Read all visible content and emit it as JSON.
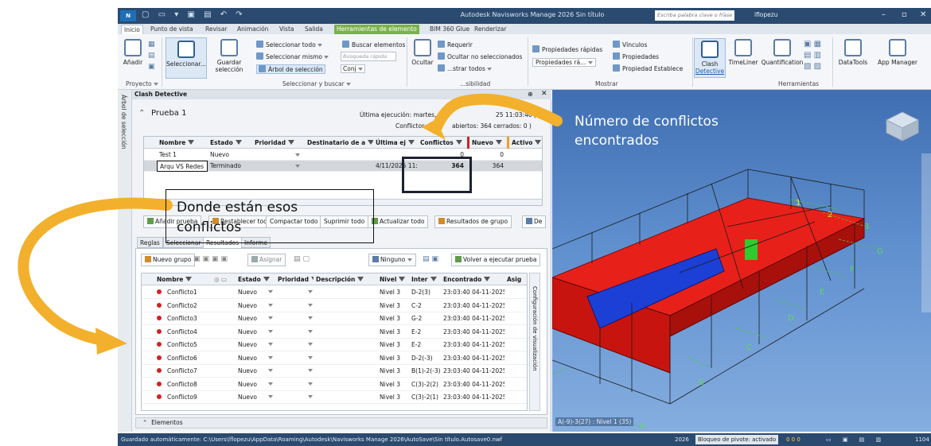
{
  "window": {
    "title": "Autodesk Navisworks Manage 2026   Sin título",
    "logo": "N",
    "search_placeholder": "Escriba palabra clave o frase",
    "user": "lflopezu"
  },
  "menu": {
    "tabs": [
      "Inicio",
      "Punto de vista",
      "Revisar",
      "Animación",
      "Vista",
      "Salida",
      "Herramientas de elemento",
      "BIM 360 Glue",
      "Renderizar"
    ]
  },
  "ribbon": {
    "anadir": "Añadir",
    "seleccionar": "Seleccionar...",
    "guardar": "Guardar",
    "seleccion": "selección",
    "seleccionar_todo": "Seleccionar todo",
    "seleccionar_mismo": "Seleccionar mismo",
    "arbol_seleccion": "Árbol de selección",
    "buscar_elementos": "Buscar elementos",
    "busqueda_rapida": "Búsqueda rápida",
    "conj": "Conj",
    "ocultar": "Ocultar",
    "requerir": "Requerir",
    "ocultar_no_sel": "Ocultar no seleccionados",
    "mostrar_todos": "...strar todos",
    "prop_rapidas": "Propiedades rápidas",
    "prop_ra": "Propiedades rá...",
    "vinculos": "Vínculos",
    "propiedades": "Propiedades",
    "prop_establece": "Propiedad Establece",
    "clash": "Clash",
    "detective": "Detective",
    "timeliner": "TimeLiner",
    "quantification": "Quantification",
    "datatools": "DataTools",
    "app_manager": "App Manager",
    "groups": {
      "proyecto": "Proyecto",
      "seleccionar_buscar": "Seleccionar y buscar",
      "visibilidad": "...sibilidad",
      "mostrar": "Mostrar",
      "herramientas": "Herramientas"
    }
  },
  "left_strip": {
    "label": "Árbol de selección"
  },
  "clash": {
    "header": "Clash Detective",
    "test_name": "Prueba 1",
    "ultima_ejecucion": "Última ejecución:  martes,",
    "ultima_time": "25 11:03:40 p. m.",
    "conflictos_summary": "Conflictos: T",
    "abiertos_summary": "abiertos: 364  cerrados: 0 )",
    "tests_table": {
      "columns": [
        "Nombre",
        "Estado",
        "Prioridad",
        "Destinatario de a",
        "Última ej",
        "Conflictos",
        "Nuevo",
        "Activo"
      ],
      "rows": [
        [
          "Test 1",
          "Nuevo",
          "",
          "",
          "",
          "0",
          "0",
          ""
        ],
        [
          "Arqu VS Redes",
          "Terminado",
          "",
          "",
          "4/11/2025 11:",
          "364",
          "364",
          ""
        ]
      ]
    },
    "buttons": {
      "anadir_prueba": "Añadir prueba",
      "restablecer": "Restablecer todo",
      "compactar": "Compactar todo",
      "suprimir": "Suprimir todo",
      "actualizar": "Actualizar todo",
      "resultados_grupo": "Resultados de grupo",
      "de": "De"
    },
    "subtabs": [
      "Reglas",
      "Seleccionar",
      "Resultados",
      "Informe"
    ],
    "results_toolbar": {
      "nuevo_grupo": "Nuevo grupo",
      "asignar": "Asignar",
      "ninguno": "Ninguno",
      "volver": "Volver a ejecutar prueba"
    },
    "results_table": {
      "columns": [
        "Nombre",
        "Estado",
        "Prioridad",
        "Descripción",
        "Nivel",
        "Inter",
        "Encontrado",
        "Asig"
      ],
      "rows": [
        [
          "Conflicto1",
          "Nuevo",
          "Nivel 3",
          "D-2(3)",
          "23:03:40 04-11-2025"
        ],
        [
          "Conflicto2",
          "Nuevo",
          "Nivel 3",
          "C-2",
          "23:03:40 04-11-2025"
        ],
        [
          "Conflicto3",
          "Nuevo",
          "Nivel 3",
          "G-2",
          "23:03:40 04-11-2025"
        ],
        [
          "Conflicto4",
          "Nuevo",
          "Nivel 3",
          "E-2",
          "23:03:40 04-11-2025"
        ],
        [
          "Conflicto5",
          "Nuevo",
          "Nivel 3",
          "E-2",
          "23:03:40 04-11-2025"
        ],
        [
          "Conflicto6",
          "Nuevo",
          "Nivel 3",
          "D-2(-3)",
          "23:03:40 04-11-2025"
        ],
        [
          "Conflicto7",
          "Nuevo",
          "Nivel 3",
          "B(1)-2(-3)",
          "23:03:40 04-11-2025"
        ],
        [
          "Conflicto8",
          "Nuevo",
          "Nivel 3",
          "C(3)-2(2)",
          "23:03:40 04-11-2025"
        ],
        [
          "Conflicto9",
          "Nuevo",
          "Nivel 3",
          "C(3)-2(1)",
          "23:03:40 04-11-2025"
        ]
      ]
    },
    "config_label": "Configuración de visualización",
    "elementos": "Elementos"
  },
  "viewport": {
    "grid_labels": [
      "1",
      "2",
      "3",
      "G",
      "F",
      "E",
      "D",
      "C",
      "B",
      "A"
    ],
    "coords": "A(-9)-3(27) : Nivel 1 (35)"
  },
  "statusbar": {
    "path": "Guardado automáticamente: C:\\Users\\lflopezu\\AppData\\Roaming\\Autodesk\\Navisworks Manage 2026\\AutoSave\\Sin título.Autosave0.nwf",
    "year": "2026",
    "pivot": "Bloqueo de pivote: activado",
    "counts": "0   0   0",
    "zoom": "1104"
  },
  "annotations": {
    "num_conflictos": [
      "Número de conflictos",
      "encontrados"
    ],
    "donde_estan": [
      "Donde están esos",
      "conflictos"
    ]
  },
  "colors": {
    "title_bar": "#2b4a6f",
    "context_tab": "#7bb14a",
    "clash_red": "#e8201a",
    "clash_blue": "#1c3fd6",
    "arrow": "#f3b02c"
  }
}
